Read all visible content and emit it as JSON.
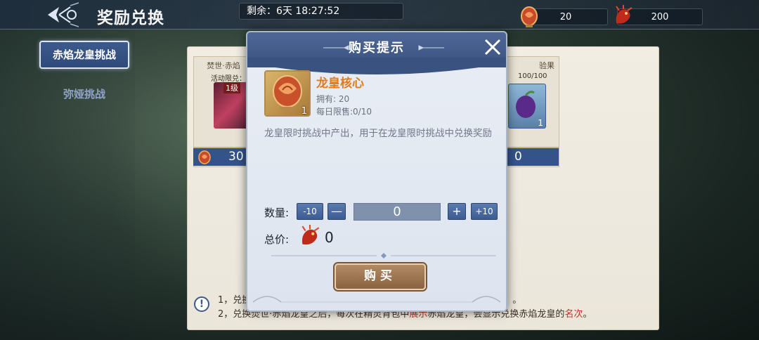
{
  "header": {
    "title": "奖励兑换",
    "timer": "剩余：6天 18:27:52"
  },
  "currencies": [
    {
      "icon": "dragon-core-icon",
      "value": "20"
    },
    {
      "icon": "red-dragon-icon",
      "value": "200"
    }
  ],
  "nav": {
    "tabs": [
      {
        "label": "赤焰龙皇挑战",
        "active": true
      },
      {
        "label": "弥娅挑战",
        "active": false
      }
    ]
  },
  "cards": {
    "left": {
      "title": "焚世·赤焰",
      "limit": "活动限兑：",
      "level": "1级",
      "price": "30"
    },
    "right": {
      "title": "验果",
      "limit": "100/100",
      "count": "1",
      "price": "0"
    }
  },
  "notes": {
    "line1_prefix": "1，兑换",
    "line1_suffix": "。",
    "line2_a": "2，兑换焚世·赤焰龙皇之后，每次在精灵背包中",
    "line2_red1": "展示",
    "line2_b": "赤焰龙皇，会显示兑换赤焰龙皇的",
    "line2_red2": "名次",
    "line2_c": "。"
  },
  "dialog": {
    "title": "购买提示",
    "item": {
      "name": "龙皇核心",
      "owned": "拥有: 20",
      "daily_limit": "每日限售:0/10",
      "count": "1"
    },
    "description": "龙皇限时挑战中产出，用于在龙皇限时挑战中兑换奖励",
    "quantity": {
      "label": "数量:",
      "minus10": "-10",
      "minus": "—",
      "value": "0",
      "plus": "+",
      "plus10": "+10"
    },
    "total": {
      "label": "总价:",
      "value": "0"
    },
    "buy_label": "购买"
  },
  "colors": {
    "accent": "#3d5a8c",
    "item_name": "#e07a1a",
    "highlight_red": "#c0302a"
  }
}
